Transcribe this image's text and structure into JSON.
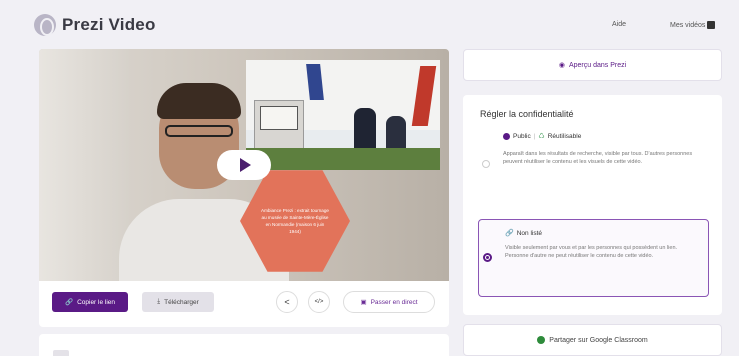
{
  "app": {
    "name": "Prezi Video",
    "nav": {
      "help": "Aide",
      "my_videos": "Mes vidéos"
    }
  },
  "video": {
    "hexagon_text": "Ambiance Prezi : extrait tournage au musée de Sainte-Mère-Église en Normandie (maison 6 juin 1944)"
  },
  "actions": {
    "copy_link": "Copier le lien",
    "download": "Télécharger",
    "go_live": "Passer en direct"
  },
  "side": {
    "preview_label": "Aperçu dans Prezi",
    "privacy_title": "Régler la confidentialité",
    "public": {
      "label": "Public",
      "reusable": "Réutilisable",
      "separator": "|",
      "desc": "Apparaît dans les résultats de recherche, visible par tous. D'autres personnes peuvent réutiliser le contenu et les visuels de cette vidéo."
    },
    "unlisted": {
      "label": "Non listé",
      "desc": "Visible seulement par vous et par les personnes qui possèdent un lien. Personne d'autre ne peut réutiliser le contenu de cette vidéo."
    },
    "classroom_label": "Partager sur Google Classroom"
  },
  "colors": {
    "brand": "#5a1a86",
    "accent": "#e2735a"
  }
}
